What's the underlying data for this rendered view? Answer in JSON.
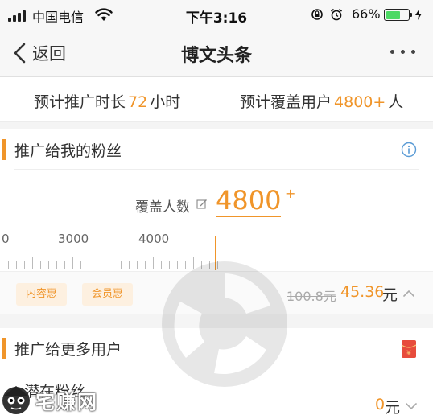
{
  "status_bar": {
    "carrier": "中国电信",
    "time": "下午3:16",
    "battery_percent": "66%",
    "battery_level": 0.66,
    "icons": [
      "signal-icon",
      "wifi-icon",
      "orientation-lock-icon",
      "alarm-icon",
      "battery-icon",
      "charging-icon"
    ]
  },
  "nav": {
    "back_label": "返回",
    "title": "博文头条"
  },
  "estimate": {
    "duration_prefix": "预计推广时长",
    "duration_value": "72",
    "duration_suffix": "小时",
    "coverage_prefix": "预计覆盖用户",
    "coverage_value": "4800+",
    "coverage_suffix": "人"
  },
  "fans_section": {
    "title": "推广给我的粉丝",
    "cover_label": "覆盖人数",
    "cover_value": "4800",
    "cover_plus": "+",
    "ruler_labels": [
      "0",
      "3000",
      "4000"
    ],
    "tags": [
      "内容惠",
      "会员惠"
    ],
    "original_price": "100.8元",
    "price": "45.36",
    "price_unit": "元"
  },
  "more_users_section": {
    "title": "推广给更多用户",
    "fans_label": "潜在粉丝",
    "fans_value": "0",
    "fans_unit": "元"
  },
  "watermark": {
    "text": "宅赚网"
  },
  "colors": {
    "accent": "#f0952a",
    "tag_bg": "#fdf0e0",
    "battery": "#4cd964",
    "info": "#5a9bd5",
    "redpacket": "#e74c3c"
  }
}
